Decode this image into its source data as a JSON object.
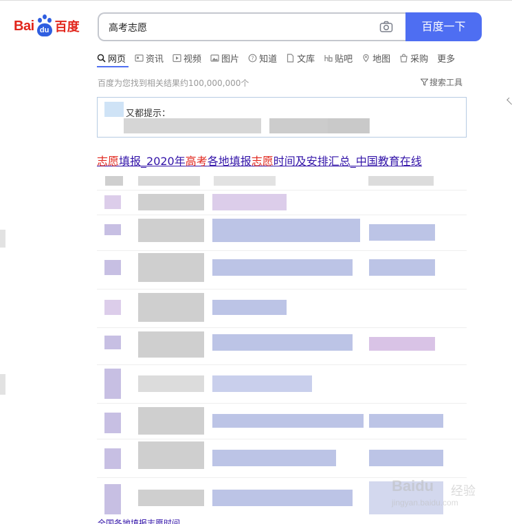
{
  "logo": {
    "bai": "Bai",
    "du": "du",
    "cn": "百度"
  },
  "search": {
    "query": "高考志愿",
    "button_label": "百度一下"
  },
  "tabs": [
    {
      "label": "网页",
      "icon": "search-icon"
    },
    {
      "label": "资讯",
      "icon": "news-icon"
    },
    {
      "label": "视频",
      "icon": "video-icon"
    },
    {
      "label": "图片",
      "icon": "image-icon"
    },
    {
      "label": "知道",
      "icon": "question-icon"
    },
    {
      "label": "文库",
      "icon": "document-icon"
    },
    {
      "label": "贴吧",
      "icon": "tieba-icon"
    },
    {
      "label": "地图",
      "icon": "map-icon"
    },
    {
      "label": "采购",
      "icon": "shop-icon"
    },
    {
      "label": "更多",
      "icon": ""
    }
  ],
  "results_info": {
    "count_text": "百度为您找到相关结果约100,000,000个",
    "tools_label": "搜索工具"
  },
  "hint": {
    "label": "又都提示："
  },
  "result": {
    "title_parts": [
      {
        "text": "志愿",
        "hl": true
      },
      {
        "text": "填报_2020年",
        "hl": false
      },
      {
        "text": "高考",
        "hl": true
      },
      {
        "text": "各地填报",
        "hl": false
      },
      {
        "text": "志愿",
        "hl": true
      },
      {
        "text": "时间及安排汇总_中国教育在线",
        "hl": false
      }
    ]
  },
  "footer": {
    "link": "全国各地填报志愿时间"
  },
  "watermark": {
    "brand": "Baidu",
    "cn": "经验",
    "url": "jingyan.baidu.com"
  },
  "colors": {
    "accent": "#4e6ef2",
    "logo_red": "#e1251b",
    "link": "#3213a8"
  }
}
